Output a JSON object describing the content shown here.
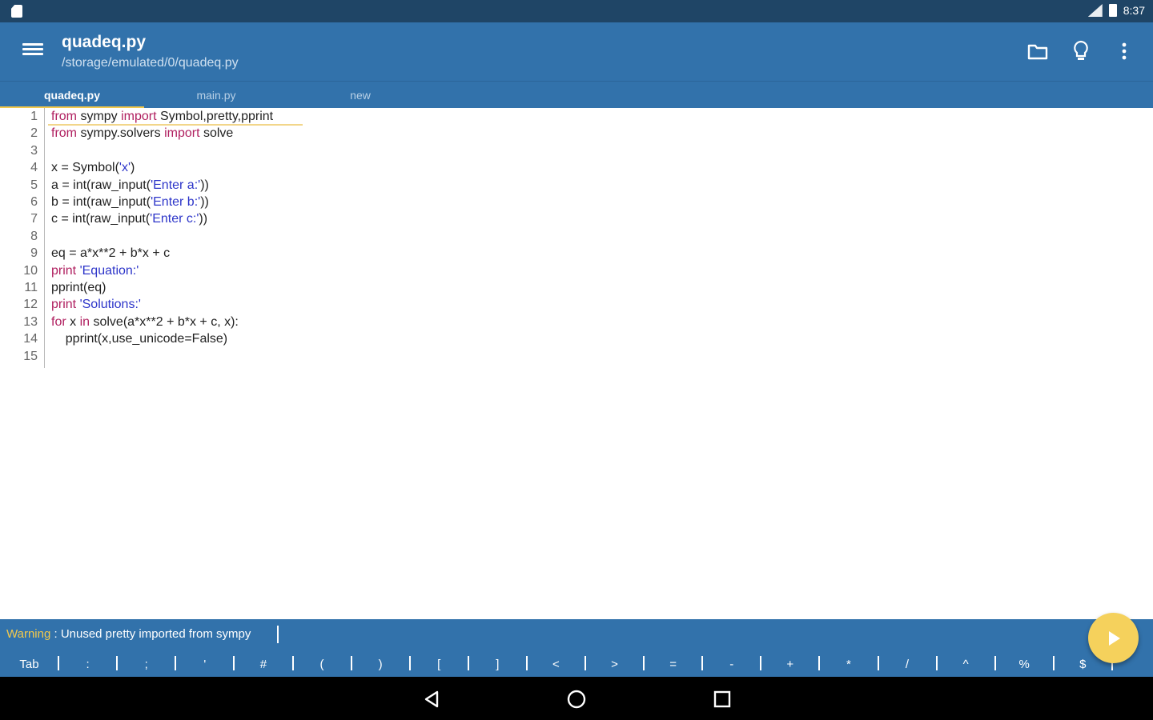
{
  "status_bar": {
    "time": "8:37"
  },
  "app_bar": {
    "title": "quadeq.py",
    "subtitle": "/storage/emulated/0/quadeq.py"
  },
  "tabs": [
    {
      "label": "quadeq.py",
      "active": true
    },
    {
      "label": "main.py",
      "active": false
    },
    {
      "label": "new",
      "active": false
    }
  ],
  "editor": {
    "line_numbers": [
      "1",
      "2",
      "3",
      "4",
      "5",
      "6",
      "7",
      "8",
      "9",
      "10",
      "11",
      "12",
      "13",
      "14",
      "15"
    ],
    "lines": [
      {
        "segments": [
          [
            "kw",
            "from"
          ],
          [
            "t",
            " sympy "
          ],
          [
            "kw",
            "import"
          ],
          [
            "t",
            " Symbol,pretty,pprint"
          ]
        ]
      },
      {
        "segments": [
          [
            "kw",
            "from"
          ],
          [
            "t",
            " sympy.solvers "
          ],
          [
            "kw",
            "import"
          ],
          [
            "t",
            " solve"
          ]
        ]
      },
      {
        "segments": []
      },
      {
        "segments": [
          [
            "t",
            "x = Symbol("
          ],
          [
            "str",
            "'x'"
          ],
          [
            "t",
            ")"
          ]
        ]
      },
      {
        "segments": [
          [
            "t",
            "a = int(raw_input("
          ],
          [
            "str",
            "'Enter a:'"
          ],
          [
            "t",
            "))"
          ]
        ]
      },
      {
        "segments": [
          [
            "t",
            "b = int(raw_input("
          ],
          [
            "str",
            "'Enter b:'"
          ],
          [
            "t",
            "))"
          ]
        ]
      },
      {
        "segments": [
          [
            "t",
            "c = int(raw_input("
          ],
          [
            "str",
            "'Enter c:'"
          ],
          [
            "t",
            "))"
          ]
        ]
      },
      {
        "segments": []
      },
      {
        "segments": [
          [
            "t",
            "eq = a*x**2 + b*x + c"
          ]
        ]
      },
      {
        "segments": [
          [
            "kw",
            "print"
          ],
          [
            "t",
            " "
          ],
          [
            "str",
            "'Equation:'"
          ]
        ]
      },
      {
        "segments": [
          [
            "t",
            "pprint(eq)"
          ]
        ]
      },
      {
        "segments": [
          [
            "kw",
            "print"
          ],
          [
            "t",
            " "
          ],
          [
            "str",
            "'Solutions:'"
          ]
        ]
      },
      {
        "segments": [
          [
            "kw",
            "for"
          ],
          [
            "t",
            " x "
          ],
          [
            "kw",
            "in"
          ],
          [
            "t",
            " solve(a*x**2 + b*x + c, x):"
          ]
        ]
      },
      {
        "segments": [
          [
            "t",
            "    pprint(x,use_unicode=False)"
          ]
        ]
      },
      {
        "segments": []
      }
    ]
  },
  "warning": {
    "label": "Warning",
    "message": " : Unused pretty imported from sympy"
  },
  "keys": [
    "Tab",
    ":",
    ";",
    "'",
    "#",
    "(",
    ")",
    "[",
    "]",
    "<",
    ">",
    "=",
    "-",
    "+",
    "*",
    "/",
    "^",
    "%",
    "$"
  ],
  "icons": {
    "menu": "hamburger-menu-icon",
    "folder": "folder-icon",
    "lightbulb": "lightbulb-icon",
    "more": "more-vert-icon",
    "run": "play-icon",
    "back": "back-triangle-icon",
    "home": "home-circle-icon",
    "recents": "recents-square-icon"
  },
  "colors": {
    "primary": "#3272ab",
    "status_bar": "#1f4566",
    "accent": "#f5d15c",
    "keyword": "#b02060",
    "string": "#2d35c9"
  }
}
